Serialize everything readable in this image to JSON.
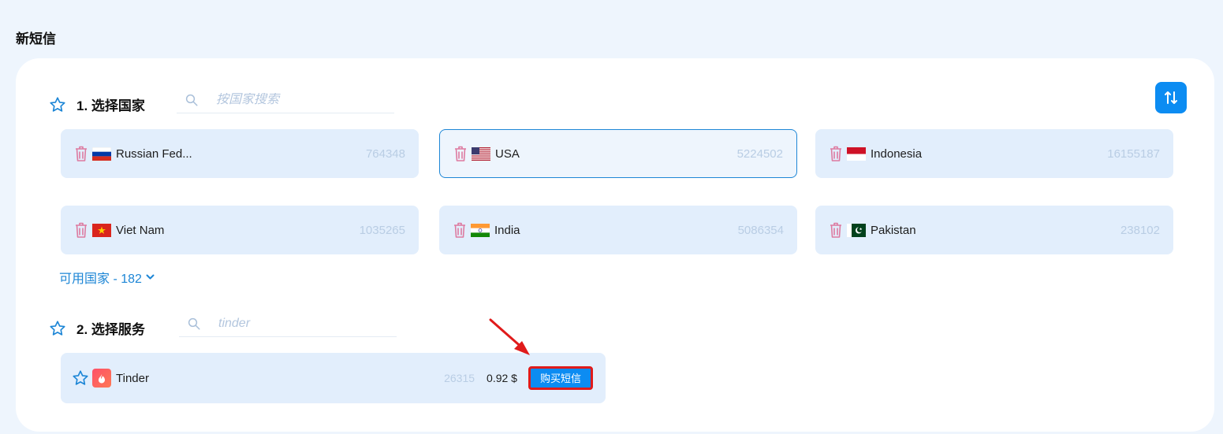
{
  "page": {
    "title": "新短信"
  },
  "section1": {
    "title": "1. 选择国家",
    "search_placeholder": "按国家搜索",
    "countries": [
      {
        "name": "Russian Fed...",
        "count": "764348",
        "flag": "russia-flag"
      },
      {
        "name": "USA",
        "count": "5224502",
        "flag": "usa-flag",
        "selected": true
      },
      {
        "name": "Indonesia",
        "count": "16155187",
        "flag": "indonesia-flag"
      },
      {
        "name": "Viet Nam",
        "count": "1035265",
        "flag": "vietnam-flag"
      },
      {
        "name": "India",
        "count": "5086354",
        "flag": "india-flag"
      },
      {
        "name": "Pakistan",
        "count": "238102",
        "flag": "pakistan-flag"
      }
    ],
    "available_label": "可用国家 - 182"
  },
  "section2": {
    "title": "2. 选择服务",
    "search_value": "tinder",
    "services": [
      {
        "name": "Tinder",
        "count": "26315",
        "price": "0.92 $",
        "buy_label": "购买短信"
      }
    ]
  },
  "colors": {
    "accent": "#0c8cf2",
    "card_bg": "#e2eefc",
    "page_bg": "#eef5fd",
    "highlight": "#e01b1b"
  }
}
